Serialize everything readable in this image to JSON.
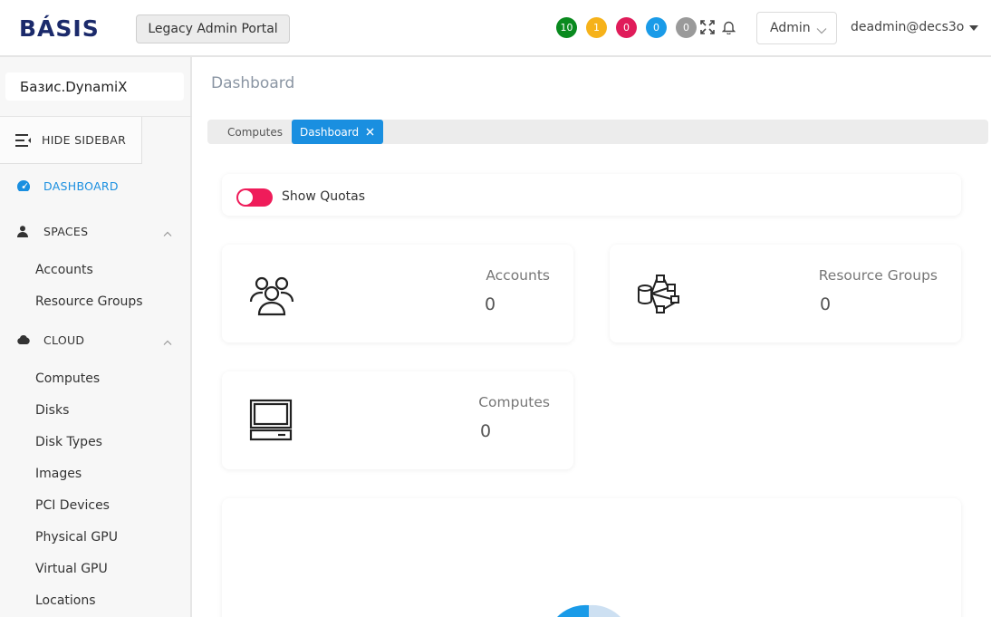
{
  "header": {
    "logo": "BÁSIS",
    "legacy_button": "Legacy Admin Portal",
    "badges": [
      {
        "value": "10",
        "color": "#0a8a1f"
      },
      {
        "value": "1",
        "color": "#f6b21a"
      },
      {
        "value": "0",
        "color": "#e01c5a"
      },
      {
        "value": "0",
        "color": "#1a9be8"
      },
      {
        "value": "0",
        "color": "#9a9a9a"
      }
    ],
    "role": "Admin",
    "user": "deadmin@decs3o"
  },
  "sidebar": {
    "org": "Базис.DynamiX",
    "hide_sidebar": "HIDE SIDEBAR",
    "dashboard": "DASHBOARD",
    "spaces": {
      "label": "SPACES",
      "items": [
        "Accounts",
        "Resource Groups"
      ]
    },
    "cloud": {
      "label": "CLOUD",
      "items": [
        "Computes",
        "Disks",
        "Disk Types",
        "Images",
        "PCI Devices",
        "Physical GPU",
        "Virtual GPU",
        "Locations"
      ]
    }
  },
  "main": {
    "title": "Dashboard",
    "tabs": [
      "Computes",
      "Dashboard"
    ],
    "show_quotas": "Show Quotas",
    "stats": [
      {
        "label": "Accounts",
        "value": "0"
      },
      {
        "label": "Resource Groups",
        "value": "0"
      },
      {
        "label": "Computes",
        "value": "0"
      }
    ]
  },
  "colors": {
    "accent": "#1a8fe0",
    "toggle": "#ef1c5a"
  }
}
